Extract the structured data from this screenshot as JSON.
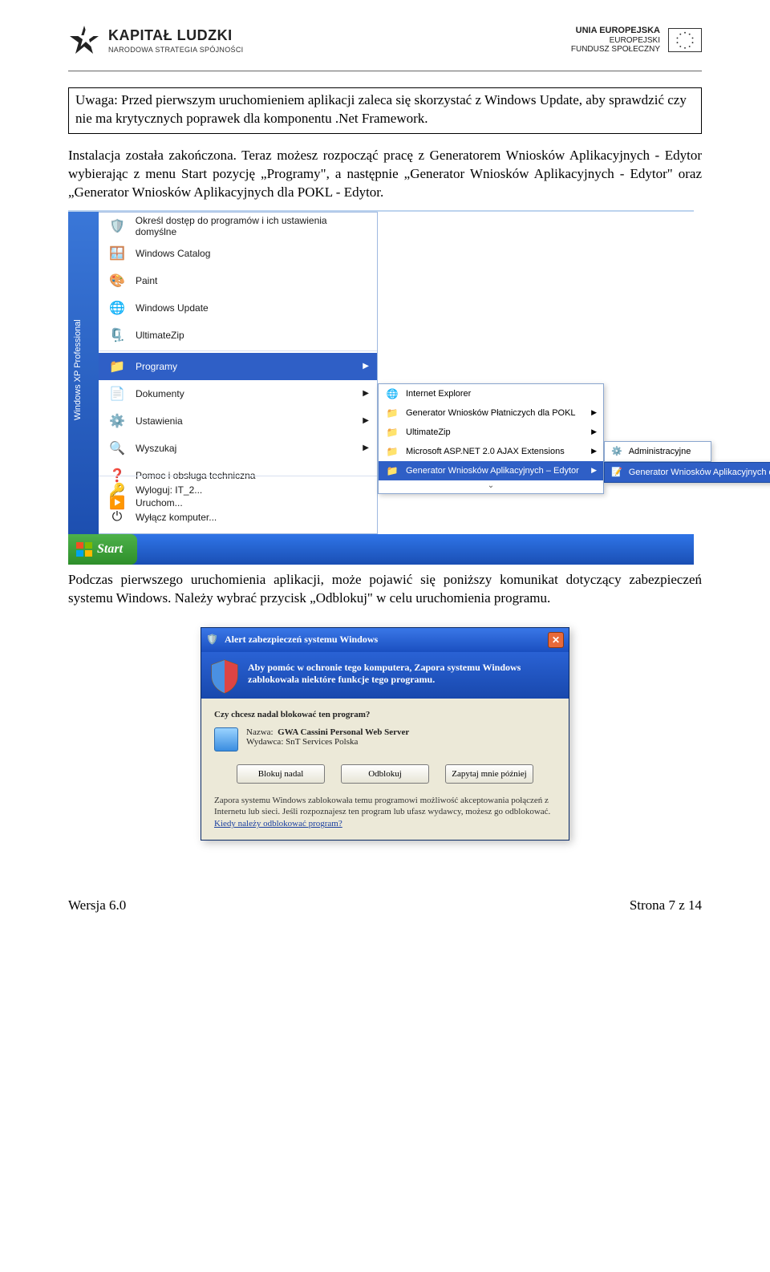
{
  "header": {
    "left_title": "KAPITAŁ LUDZKI",
    "left_sub": "NARODOWA STRATEGIA SPÓJNOŚCI",
    "right_l1": "UNIA EUROPEJSKA",
    "right_l2": "EUROPEJSKI",
    "right_l3": "FUNDUSZ SPOŁECZNY"
  },
  "note": "Uwaga: Przed pierwszym uruchomieniem aplikacji zaleca się skorzystać z Windows Update, aby sprawdzić czy nie ma krytycznych poprawek dla komponentu .Net Framework.",
  "para1": "Instalacja została zakończona. Teraz możesz rozpocząć pracę z Generatorem Wniosków Aplikacyjnych - Edytor wybierając z menu Start pozycję „Programy\", a następnie „Generator Wniosków Aplikacyjnych - Edytor\" oraz „Generator Wniosków Aplikacyjnych dla POKL - Edytor.",
  "start_menu": {
    "sidebar_text": "Windows XP Professional",
    "top_items": [
      "Określ dostęp do programów i ich ustawienia domyślne",
      "Windows Catalog",
      "Paint",
      "Windows Update",
      "UltimateZip"
    ],
    "mid_items": [
      {
        "label": "Programy",
        "hover": true
      },
      {
        "label": "Dokumenty",
        "hover": false
      },
      {
        "label": "Ustawienia",
        "hover": false
      },
      {
        "label": "Wyszukaj",
        "hover": false
      },
      {
        "label": "Pomoc i obsługa techniczna",
        "hover": false
      },
      {
        "label": "Uruchom...",
        "hover": false
      }
    ],
    "bot_items": [
      "Wyloguj: IT_2...",
      "Wyłącz komputer..."
    ],
    "sub_items": [
      {
        "label": "Internet Explorer"
      },
      {
        "label": "Generator Wniosków Płatniczych dla POKL"
      },
      {
        "label": "UltimateZip"
      },
      {
        "label": "Microsoft ASP.NET 2.0 AJAX Extensions"
      },
      {
        "label": "Generator Wniosków Aplikacyjnych – Edytor",
        "hover": true
      }
    ],
    "sub3a": "Administracyjne",
    "sub3b": "Generator Wniosków Aplikacyjnych dla POKL - Edytor",
    "start_label": "Start"
  },
  "para2": "Podczas pierwszego uruchomienia aplikacji, może pojawić się poniższy komunikat dotyczący zabezpieczeń systemu Windows. Należy wybrać przycisk „Odblokuj\" w celu uruchomienia programu.",
  "alert": {
    "title": "Alert zabezpieczeń systemu Windows",
    "banner": "Aby pomóc w ochronie tego komputera, Zapora systemu Windows zablokowała niektóre funkcje tego programu.",
    "question": "Czy chcesz nadal blokować ten program?",
    "name_label": "Nazwa:",
    "name_value": "GWA Cassini Personal Web Server",
    "pub_label": "Wydawca:",
    "pub_value": "SnT Services Polska",
    "btn_block": "Blokuj nadal",
    "btn_unblock": "Odblokuj",
    "btn_later": "Zapytaj mnie później",
    "info": "Zapora systemu Windows zablokowała temu programowi możliwość akceptowania połączeń z Internetu lub sieci. Jeśli rozpoznajesz ten program lub ufasz wydawcy, możesz go odblokować. ",
    "info_link": "Kiedy należy odblokować program?"
  },
  "footer": {
    "left": "Wersja 6.0",
    "right": "Strona 7 z 14"
  }
}
